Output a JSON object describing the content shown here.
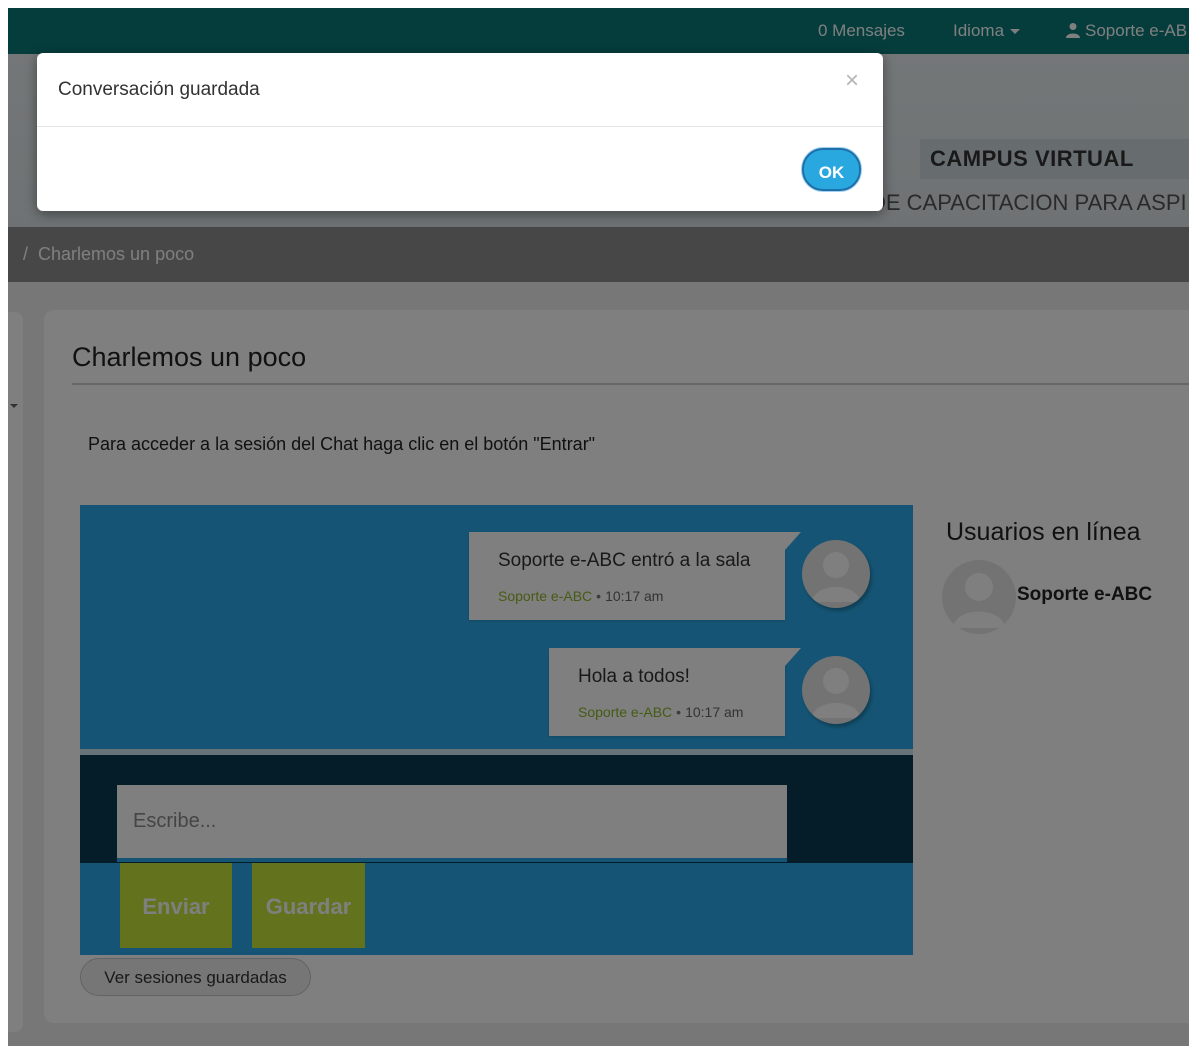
{
  "navbar": {
    "messages": "0 Mensajes",
    "language": "Idioma",
    "user": "Soporte e-AB",
    "bg_color": "#0a7b7b"
  },
  "header": {
    "campus_title": "CAMPUS VIRTUAL",
    "campus_subtitle": "DE CAPACITACION PARA ASPI"
  },
  "breadcrumb": {
    "current": "Charlemos un poco"
  },
  "page": {
    "title": "Charlemos un poco",
    "intro": "Para acceder a la sesión del Chat haga clic en el botón \"Entrar\""
  },
  "chat": {
    "messages": [
      {
        "text": "Soporte e-ABC entró a la sala",
        "author": "Soporte e-ABC",
        "time": "10:17 am"
      },
      {
        "text": "Hola a todos!",
        "author": "Soporte e-ABC",
        "time": "10:17 am"
      }
    ],
    "input_placeholder": "Escribe...",
    "send_label": "Enviar",
    "save_label": "Guardar",
    "sessions_label": "Ver sesiones guardadas",
    "accent_color": "#2aa9e8",
    "button_color": "#c5e43a"
  },
  "online_users": {
    "title": "Usuarios en línea",
    "users": [
      {
        "name": "Soporte e-ABC"
      }
    ]
  },
  "modal": {
    "title": "Conversación guardada",
    "close_icon": "×",
    "ok_label": "OK"
  }
}
